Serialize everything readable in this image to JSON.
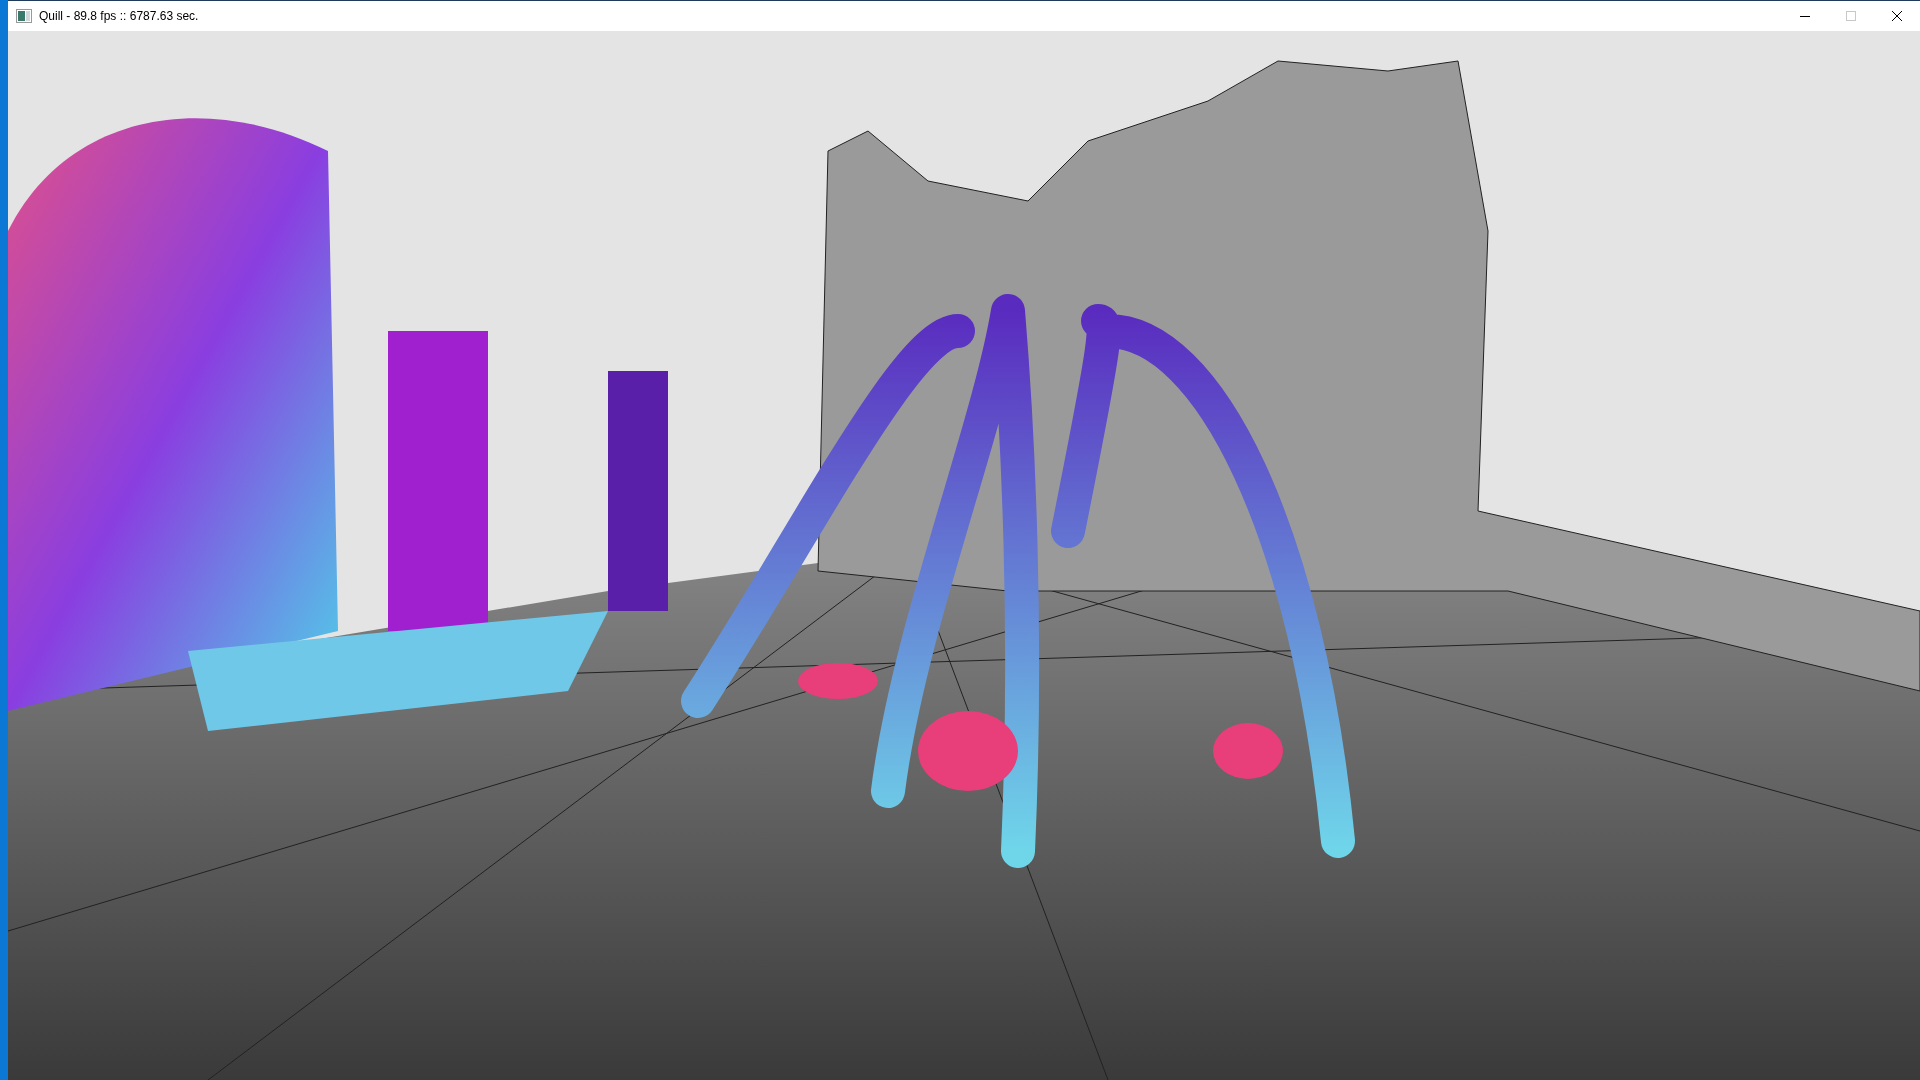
{
  "window": {
    "title": "Quill - 89.8 fps :: 6787.63 sec.",
    "controls": [
      {
        "kind": "minimize",
        "disabled": false
      },
      {
        "kind": "maximize",
        "disabled": true
      },
      {
        "kind": "close",
        "disabled": false
      }
    ]
  }
}
